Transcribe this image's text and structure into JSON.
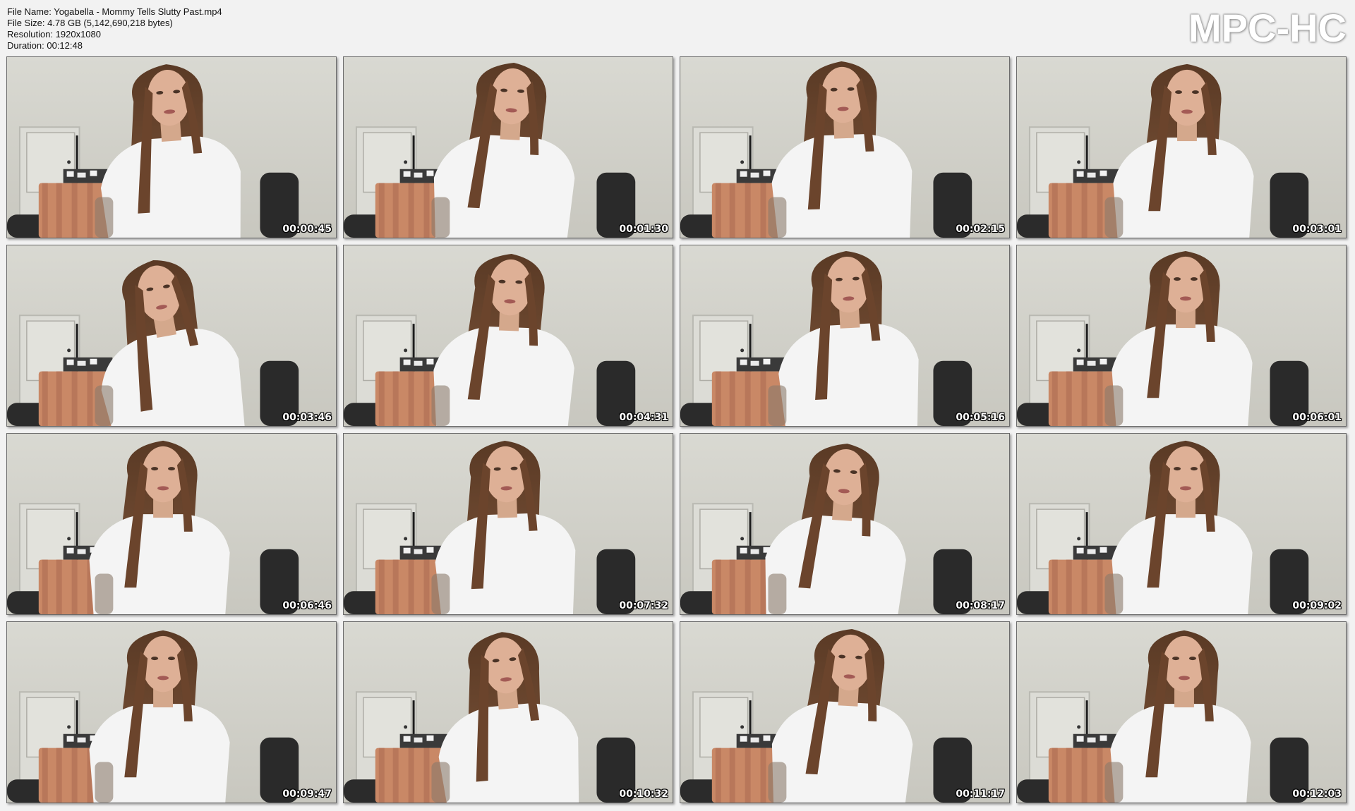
{
  "header": {
    "file_name": "File Name: Yogabella - Mommy Tells Slutty Past.mp4",
    "file_size": "File Size: 4.78 GB (5,142,690,218 bytes)",
    "resolution": "Resolution: 1920x1080",
    "duration": "Duration: 00:12:48"
  },
  "logo": "MPC-HC",
  "thumbnails": [
    {
      "timestamp": "00:00:45"
    },
    {
      "timestamp": "00:01:30"
    },
    {
      "timestamp": "00:02:15"
    },
    {
      "timestamp": "00:03:01"
    },
    {
      "timestamp": "00:03:46"
    },
    {
      "timestamp": "00:04:31"
    },
    {
      "timestamp": "00:05:16"
    },
    {
      "timestamp": "00:06:01"
    },
    {
      "timestamp": "00:06:46"
    },
    {
      "timestamp": "00:07:32"
    },
    {
      "timestamp": "00:08:17"
    },
    {
      "timestamp": "00:09:02"
    },
    {
      "timestamp": "00:09:47"
    },
    {
      "timestamp": "00:10:32"
    },
    {
      "timestamp": "00:11:17"
    },
    {
      "timestamp": "00:12:03"
    }
  ]
}
